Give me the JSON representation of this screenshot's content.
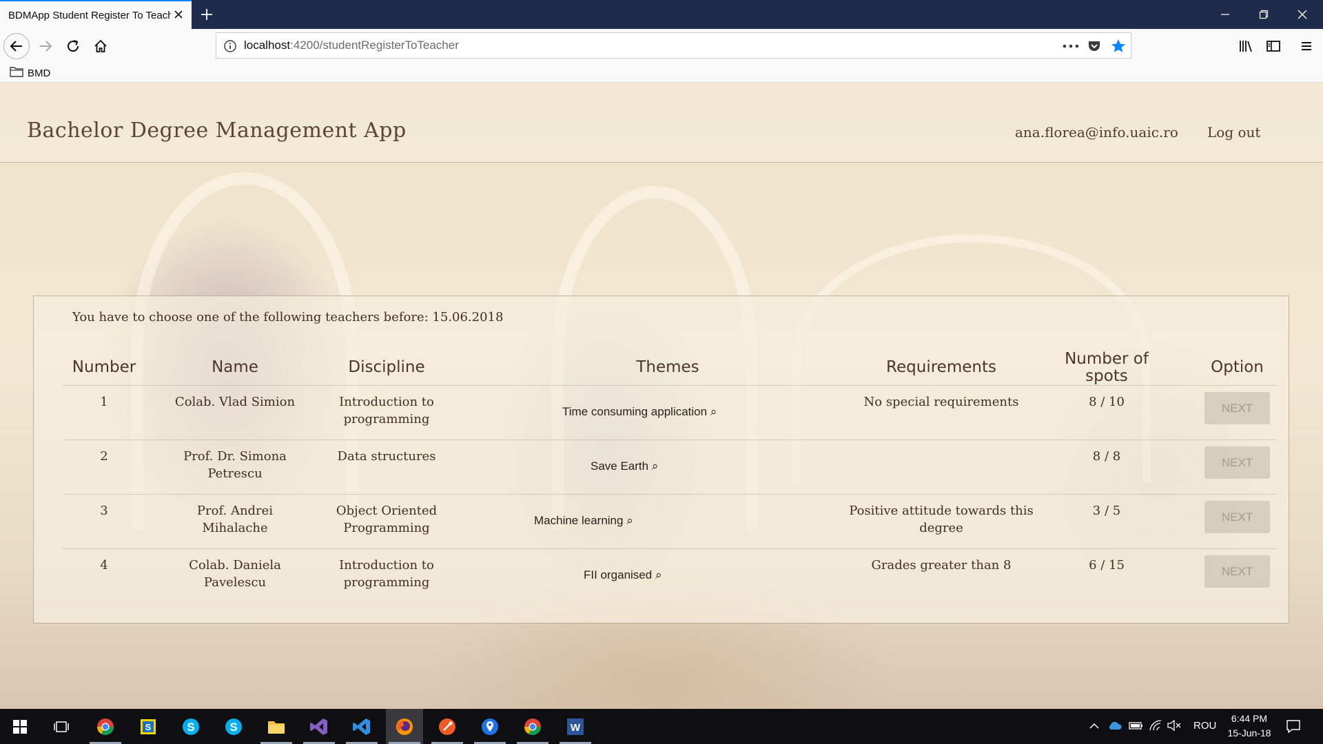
{
  "browser": {
    "tab_title": "BDMApp Student Register To Teacher",
    "url_host": "localhost",
    "url_rest": ":4200/studentRegisterToTeacher",
    "bookmark_folder": "BMD",
    "accent": "#0a84ff"
  },
  "app": {
    "title": "Bachelor Degree Management App",
    "user_email": "ana.florea@info.uaic.ro",
    "logout_label": "Log out"
  },
  "panel": {
    "notice": "You have to choose one of the following teachers before: 15.06.2018",
    "headers": {
      "number": "Number",
      "name": "Name",
      "discipline": "Discipline",
      "themes": "Themes",
      "requirements": "Requirements",
      "spots_line1": "Number of",
      "spots_line2": "spots",
      "option": "Option"
    },
    "rows": [
      {
        "number": "1",
        "name_l1": "Colab. Vlad Simion",
        "name_l2": "",
        "disc_l1": "Introduction to",
        "disc_l2": "programming",
        "theme": "Time consuming application",
        "req_l1": "No special requirements",
        "req_l2": "",
        "spots": "8 / 10",
        "option": "NEXT"
      },
      {
        "number": "2",
        "name_l1": "Prof. Dr. Simona",
        "name_l2": "Petrescu",
        "disc_l1": "Data structures",
        "disc_l2": "",
        "theme": "Save Earth",
        "req_l1": "",
        "req_l2": "",
        "spots": "8 / 8",
        "option": "NEXT"
      },
      {
        "number": "3",
        "name_l1": "Prof. Andrei",
        "name_l2": "Mihalache",
        "disc_l1": "Object Oriented",
        "disc_l2": "Programming",
        "theme": "Machine learning",
        "req_l1": "Positive attitude towards this",
        "req_l2": "degree",
        "spots": "3 / 5",
        "option": "NEXT"
      },
      {
        "number": "4",
        "name_l1": "Colab. Daniela",
        "name_l2": "Pavelescu",
        "disc_l1": "Introduction to",
        "disc_l2": "programming",
        "theme": "FII organised",
        "req_l1": "Grades greater than 8",
        "req_l2": "",
        "spots": "6 / 15",
        "option": "NEXT"
      }
    ]
  },
  "taskbar": {
    "language": "ROU",
    "time": "6:44 PM",
    "date": "15-Jun-18",
    "apps": [
      "chrome-icon",
      "skype-business-icon",
      "skype-icon",
      "skype-icon",
      "file-explorer-icon",
      "visual-studio-icon",
      "vscode-icon",
      "firefox-icon",
      "postman-icon",
      "maps-icon",
      "chrome-icon",
      "word-icon"
    ]
  }
}
